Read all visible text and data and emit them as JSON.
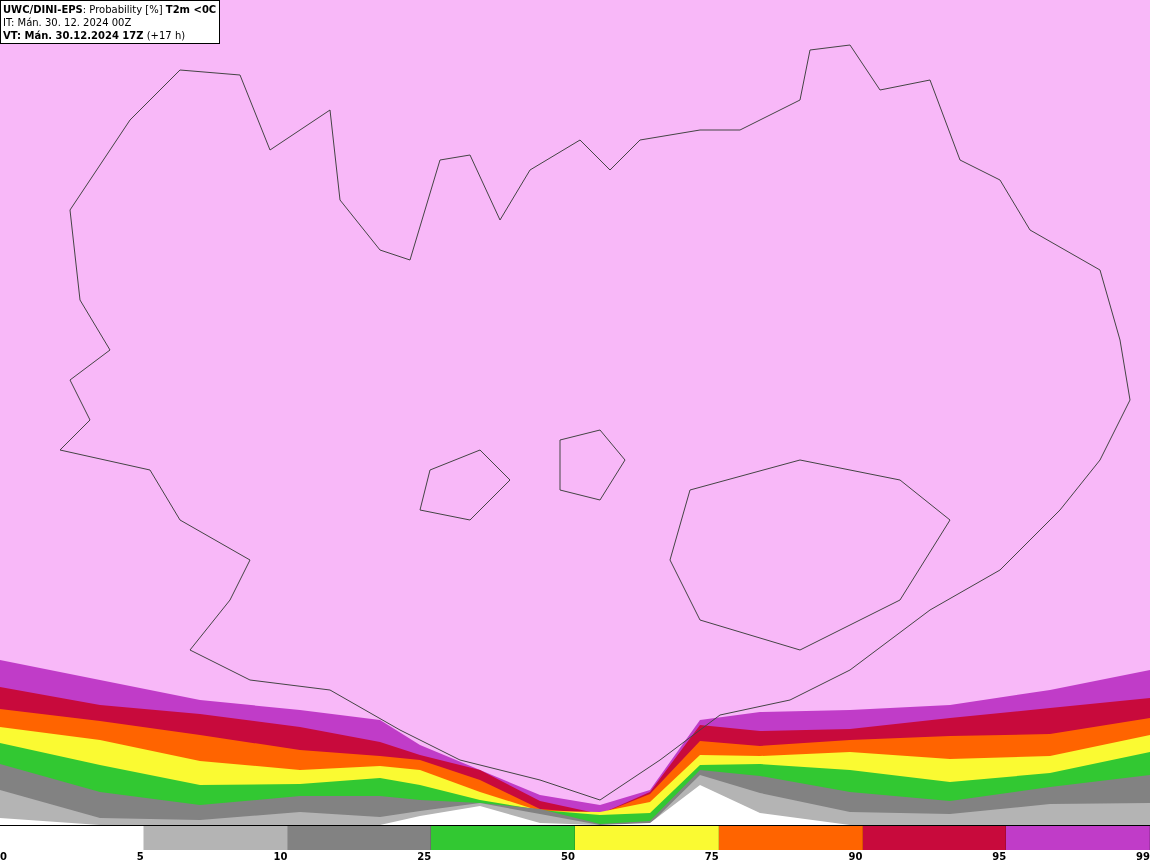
{
  "header": {
    "lines": [
      "**UWC/DINI-EPS**: Probability [%] **T2m <0C**",
      "IT: Mán. 30. 12. 2024 00Z",
      "**VT: Mán. 30.12.2024 17Z** (+17 h)"
    ]
  },
  "legend": {
    "segments": [
      {
        "color": "#ffffff"
      },
      {
        "color": "#b4b4b4"
      },
      {
        "color": "#828282"
      },
      {
        "color": "#32c832"
      },
      {
        "color": "#fafa32"
      },
      {
        "color": "#ff6400"
      },
      {
        "color": "#c80a3c"
      },
      {
        "color": "#c03cc8"
      }
    ],
    "ticks": [
      "0",
      "5",
      "10",
      "25",
      "50",
      "75",
      "90",
      "95",
      "99"
    ]
  }
}
